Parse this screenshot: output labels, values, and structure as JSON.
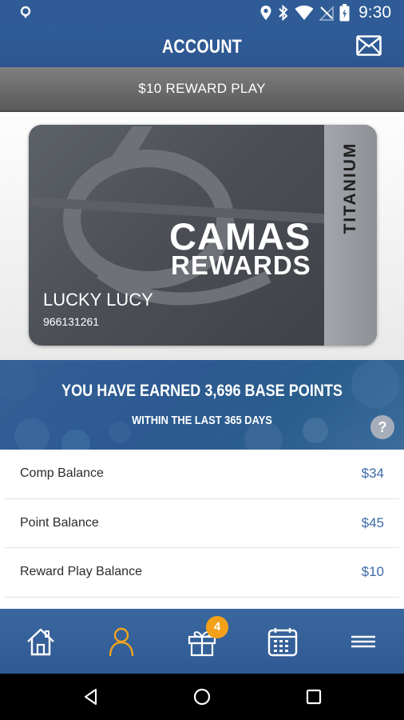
{
  "status_bar": {
    "time": "9:30",
    "left_icon": "location-pin-icon",
    "icons": [
      "location-icon",
      "bluetooth-icon",
      "wifi-icon",
      "no-signal-icon",
      "battery-icon"
    ]
  },
  "header": {
    "title": "ACCOUNT",
    "right_icon": "mail-icon"
  },
  "promo": {
    "label": "$10 REWARD PLAY"
  },
  "card": {
    "brand_line1": "CAMAS",
    "brand_line2": "REWARDS",
    "tier": "TITANIUM",
    "member_name": "LUCKY LUCY",
    "member_number": "966131261"
  },
  "points_banner": {
    "headline": "YOU HAVE EARNED 3,696 BASE POINTS",
    "subline": "WITHIN THE LAST 365 DAYS",
    "help_label": "?"
  },
  "balances": [
    {
      "label": "Comp Balance",
      "value": "$34"
    },
    {
      "label": "Point Balance",
      "value": "$45"
    },
    {
      "label": "Reward Play Balance",
      "value": "$10"
    }
  ],
  "tab_bar": {
    "tabs": [
      {
        "name": "home",
        "icon": "home-icon"
      },
      {
        "name": "account",
        "icon": "person-icon",
        "active": true
      },
      {
        "name": "offers",
        "icon": "gift-icon",
        "badge": "4"
      },
      {
        "name": "calendar",
        "icon": "calendar-icon"
      },
      {
        "name": "menu",
        "icon": "menu-icon"
      }
    ]
  },
  "colors": {
    "header_blue": "#2f5c96",
    "active_tab": "#f0a31c",
    "badge": "#f4a119",
    "balance_value": "#3d6ba6"
  }
}
